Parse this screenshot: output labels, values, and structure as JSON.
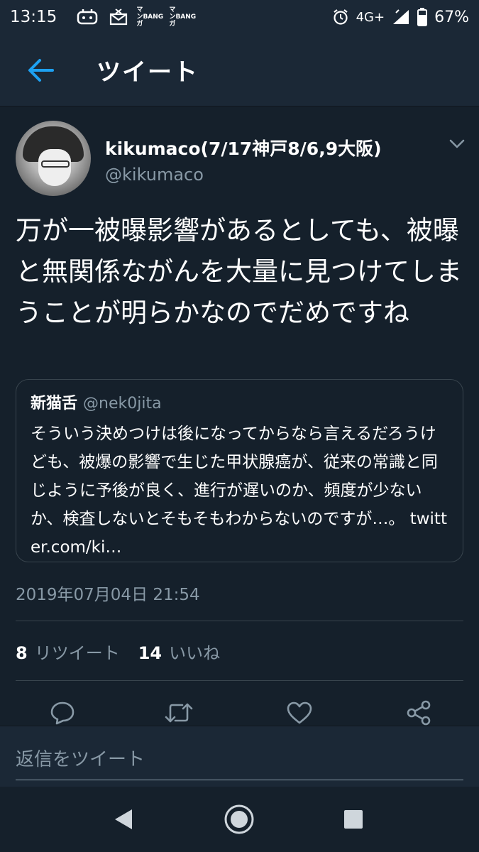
{
  "status_bar": {
    "time": "13:15",
    "notification_icons": [
      "game-controller-icon",
      "mail-x-icon",
      "manga-bang-icon",
      "manga-bang-icon"
    ],
    "manga_badge_top": "マンガ",
    "manga_badge_bottom": "BANG",
    "network": "4G+",
    "battery": "67%"
  },
  "header": {
    "title": "ツイート"
  },
  "tweet": {
    "display_name": "kikumaco(7/17神戸8/6,9大阪)",
    "handle": "@kikumaco",
    "text": "万が一被曝影響があるとしても、被曝と無関係ながんを大量に見つけてしまうことが明らかなのでだめですね",
    "timestamp": "2019年07月04日 21:54"
  },
  "quote": {
    "name": "新猫舌",
    "handle": "@nek0jita",
    "text": "そういう決めつけは後になってからなら言えるだろうけども、被爆の影響で生じた甲状腺癌が、従来の常識と同じように予後が良く、進行が遅いのか、頻度が少ないか、検査しないとそもそもわからないのですが…。 twitter.com/ki…"
  },
  "stats": {
    "retweets_count": "8",
    "retweets_label": "リツイート",
    "likes_count": "14",
    "likes_label": "いいね"
  },
  "actions": [
    "reply-icon",
    "retweet-icon",
    "like-icon",
    "share-icon"
  ],
  "reply": {
    "placeholder": "返信をツイート"
  },
  "colors": {
    "background": "#15202b",
    "bar": "#1b2836",
    "secondary_text": "#8899a6",
    "accent": "#1da1f2",
    "border": "#38444d"
  }
}
